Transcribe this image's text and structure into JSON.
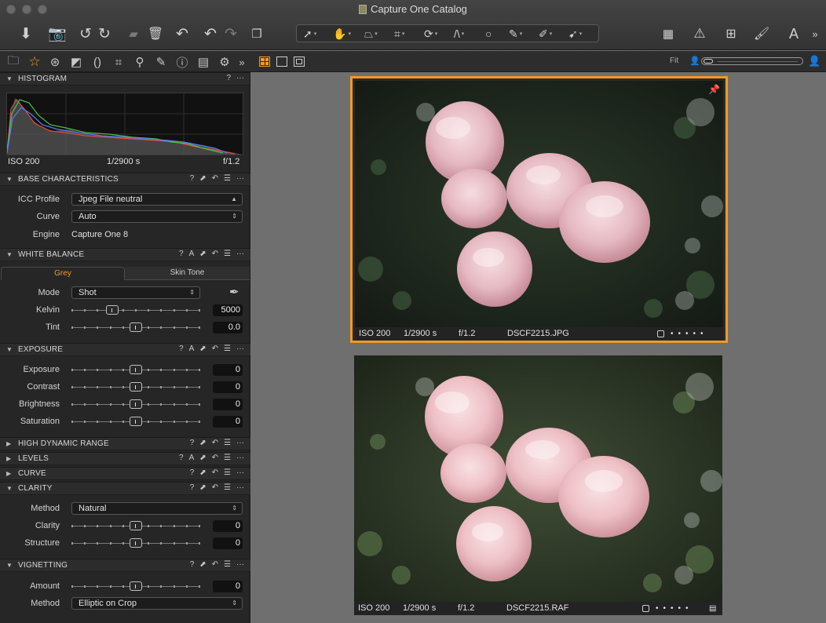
{
  "window": {
    "title": "Capture One Catalog"
  },
  "viewer": {
    "zoom_label": "Fit"
  },
  "histogram": {
    "title": "HISTOGRAM",
    "iso": "ISO 200",
    "shutter": "1/2900 s",
    "aperture": "f/1.2"
  },
  "base": {
    "title": "BASE CHARACTERISTICS",
    "icc_label": "ICC Profile",
    "icc_value": "Jpeg File neutral",
    "curve_label": "Curve",
    "curve_value": "Auto",
    "engine_label": "Engine",
    "engine_value": "Capture One 8"
  },
  "wb": {
    "title": "WHITE BALANCE",
    "tab_grey": "Grey",
    "tab_skin": "Skin Tone",
    "mode_label": "Mode",
    "mode_value": "Shot",
    "kelvin_label": "Kelvin",
    "kelvin_value": "5000",
    "tint_label": "Tint",
    "tint_value": "0.0"
  },
  "exposure": {
    "title": "EXPOSURE",
    "rows": [
      {
        "label": "Exposure",
        "value": "0"
      },
      {
        "label": "Contrast",
        "value": "0"
      },
      {
        "label": "Brightness",
        "value": "0"
      },
      {
        "label": "Saturation",
        "value": "0"
      }
    ]
  },
  "hdr": {
    "title": "HIGH DYNAMIC RANGE"
  },
  "levels": {
    "title": "LEVELS"
  },
  "curve": {
    "title": "CURVE"
  },
  "clarity": {
    "title": "CLARITY",
    "method_label": "Method",
    "method_value": "Natural",
    "clarity_label": "Clarity",
    "clarity_value": "0",
    "structure_label": "Structure",
    "structure_value": "0"
  },
  "vignetting": {
    "title": "VIGNETTING",
    "amount_label": "Amount",
    "amount_value": "0",
    "method_label": "Method",
    "method_value": "Elliptic on Crop"
  },
  "images": [
    {
      "iso": "ISO 200",
      "shutter": "1/2900 s",
      "aperture": "f/1.2",
      "filename": "DSCF2215.JPG"
    },
    {
      "iso": "ISO 200",
      "shutter": "1/2900 s",
      "aperture": "f/1.2",
      "filename": "DSCF2215.RAF"
    }
  ],
  "icons": {
    "help": "?",
    "more": "···",
    "auto": "A",
    "copy": "⬈",
    "reset": "↶",
    "presets": "☰"
  },
  "colors": {
    "accent": "#f39a23",
    "panel": "#262626",
    "viewer_bg": "#6f6f6f"
  }
}
